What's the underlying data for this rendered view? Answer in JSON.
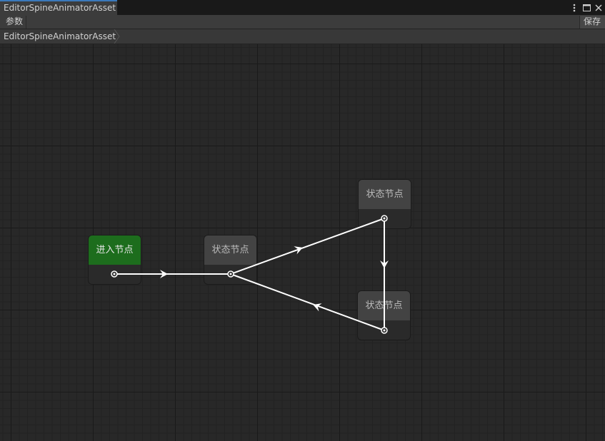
{
  "window": {
    "tab_title": "EditorSpineAnimatorAsset"
  },
  "toolbar": {
    "params_label": "参数",
    "save_label": "保存"
  },
  "breadcrumb": {
    "items": [
      "EditorSpineAnimatorAsset"
    ]
  },
  "graph": {
    "nodes": [
      {
        "id": "entry",
        "label": "进入节点",
        "kind": "entry"
      },
      {
        "id": "state1",
        "label": "状态节点",
        "kind": "state"
      },
      {
        "id": "state2",
        "label": "状态节点",
        "kind": "state"
      },
      {
        "id": "state3",
        "label": "状态节点",
        "kind": "state"
      }
    ],
    "transitions": [
      {
        "from": "entry",
        "to": "state1"
      },
      {
        "from": "state1",
        "to": "state2"
      },
      {
        "from": "state2",
        "to": "state3"
      },
      {
        "from": "state3",
        "to": "state1"
      }
    ]
  },
  "colors": {
    "tab_accent": "#3a79bb",
    "entry_node": "#1d6d1d",
    "state_node": "#434343",
    "edge": "#ffffff"
  },
  "icons": {
    "menu": "kebab-menu-icon",
    "maximize": "maximize-icon",
    "close": "close-icon"
  }
}
